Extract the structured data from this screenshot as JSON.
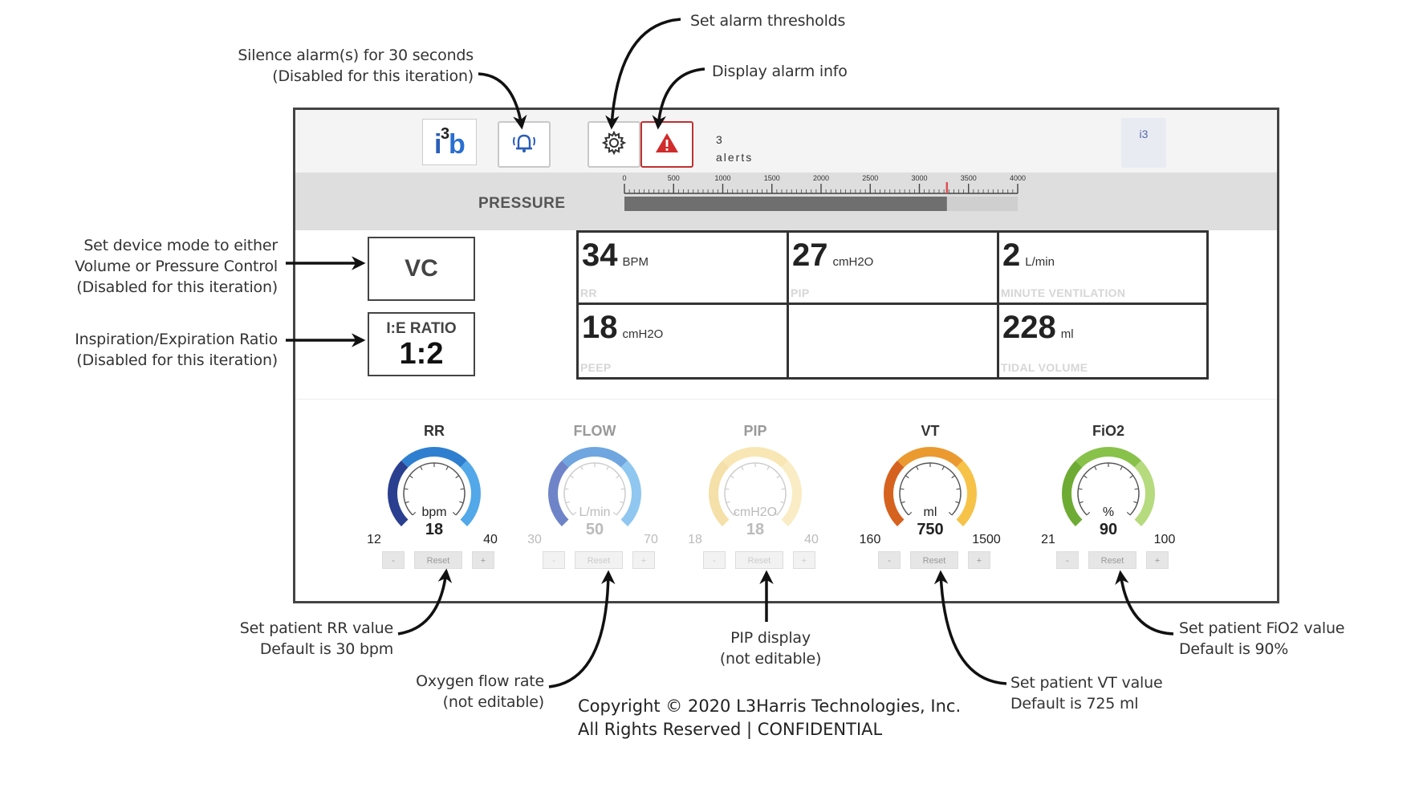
{
  "annotations": {
    "silence": [
      "Silence alarm(s) for 30 seconds",
      "(Disabled for this iteration)"
    ],
    "thresholds": "Set alarm thresholds",
    "alarm_info": "Display alarm info",
    "mode": [
      "Set device mode to either",
      "Volume or Pressure Control",
      "(Disabled for this iteration)"
    ],
    "ie": [
      "Inspiration/Expiration Ratio",
      "(Disabled for this iteration)"
    ],
    "rr": [
      "Set patient RR value",
      "Default is 30 bpm"
    ],
    "flow": [
      "Oxygen flow rate",
      "(not editable)"
    ],
    "pip": [
      "PIP display",
      "(not editable)"
    ],
    "vt": [
      "Set patient VT value",
      "Default is 725 ml"
    ],
    "fio2": [
      "Set patient FiO2 value",
      "Default is 90%"
    ]
  },
  "header": {
    "logo_text": "i3b",
    "alerts_count": "3",
    "alerts_label": "alerts",
    "version": "i3"
  },
  "pressure": {
    "label": "PRESSURE",
    "ticks": [
      "0",
      "500",
      "1000",
      "1500",
      "2000",
      "2500",
      "3000",
      "3500",
      "4000"
    ],
    "max": 4000,
    "value_fraction": 0.82,
    "marker_fraction": 0.82
  },
  "mode": {
    "value": "VC"
  },
  "ie_ratio": {
    "label": "I:E RATIO",
    "value": "1:2"
  },
  "readouts": {
    "rr": {
      "value": "34",
      "unit": "BPM",
      "label": "RR"
    },
    "pip": {
      "value": "27",
      "unit": "cmH2O",
      "label": "PIP"
    },
    "minute_ventilation": {
      "value": "2",
      "unit": "L/min",
      "label": "MINUTE VENTILATION"
    },
    "peep": {
      "value": "18",
      "unit": "cmH2O",
      "label": "PEEP"
    },
    "tidal_volume": {
      "value": "228",
      "unit": "ml",
      "label": "TIDAL VOLUME"
    }
  },
  "dials": [
    {
      "title": "RR",
      "unit": "bpm",
      "value": "18",
      "min": "12",
      "max": "40",
      "colors": [
        "#2a3f8f",
        "#2f7fd0",
        "#52a8e8"
      ],
      "minus": "-",
      "reset": "Reset",
      "plus": "+",
      "disabled": false
    },
    {
      "title": "FLOW",
      "unit": "L/min",
      "value": "50",
      "min": "30",
      "max": "70",
      "colors": [
        "#6f84c8",
        "#6fa6e0",
        "#8fc7f0"
      ],
      "minus": "-",
      "reset": "Reset",
      "plus": "+",
      "disabled": true
    },
    {
      "title": "PIP",
      "unit": "cmH2O",
      "value": "18",
      "min": "18",
      "max": "40",
      "colors": [
        "#f4e0a8",
        "#f8e6b4",
        "#faecc4"
      ],
      "minus": "-",
      "reset": "Reset",
      "plus": "+",
      "disabled": true
    },
    {
      "title": "VT",
      "unit": "ml",
      "value": "750",
      "min": "160",
      "max": "1500",
      "colors": [
        "#d6621f",
        "#eb9a2f",
        "#f6c248"
      ],
      "minus": "-",
      "reset": "Reset",
      "plus": "+",
      "disabled": false
    },
    {
      "title": "FiO2",
      "unit": "%",
      "value": "90",
      "min": "21",
      "max": "100",
      "colors": [
        "#6eab34",
        "#88c24a",
        "#b6da7e"
      ],
      "minus": "-",
      "reset": "Reset",
      "plus": "+",
      "disabled": false
    }
  ],
  "copyright": [
    "Copyright © 2020 L3Harris Technologies, Inc.",
    "All Rights Reserved | CONFIDENTIAL"
  ]
}
